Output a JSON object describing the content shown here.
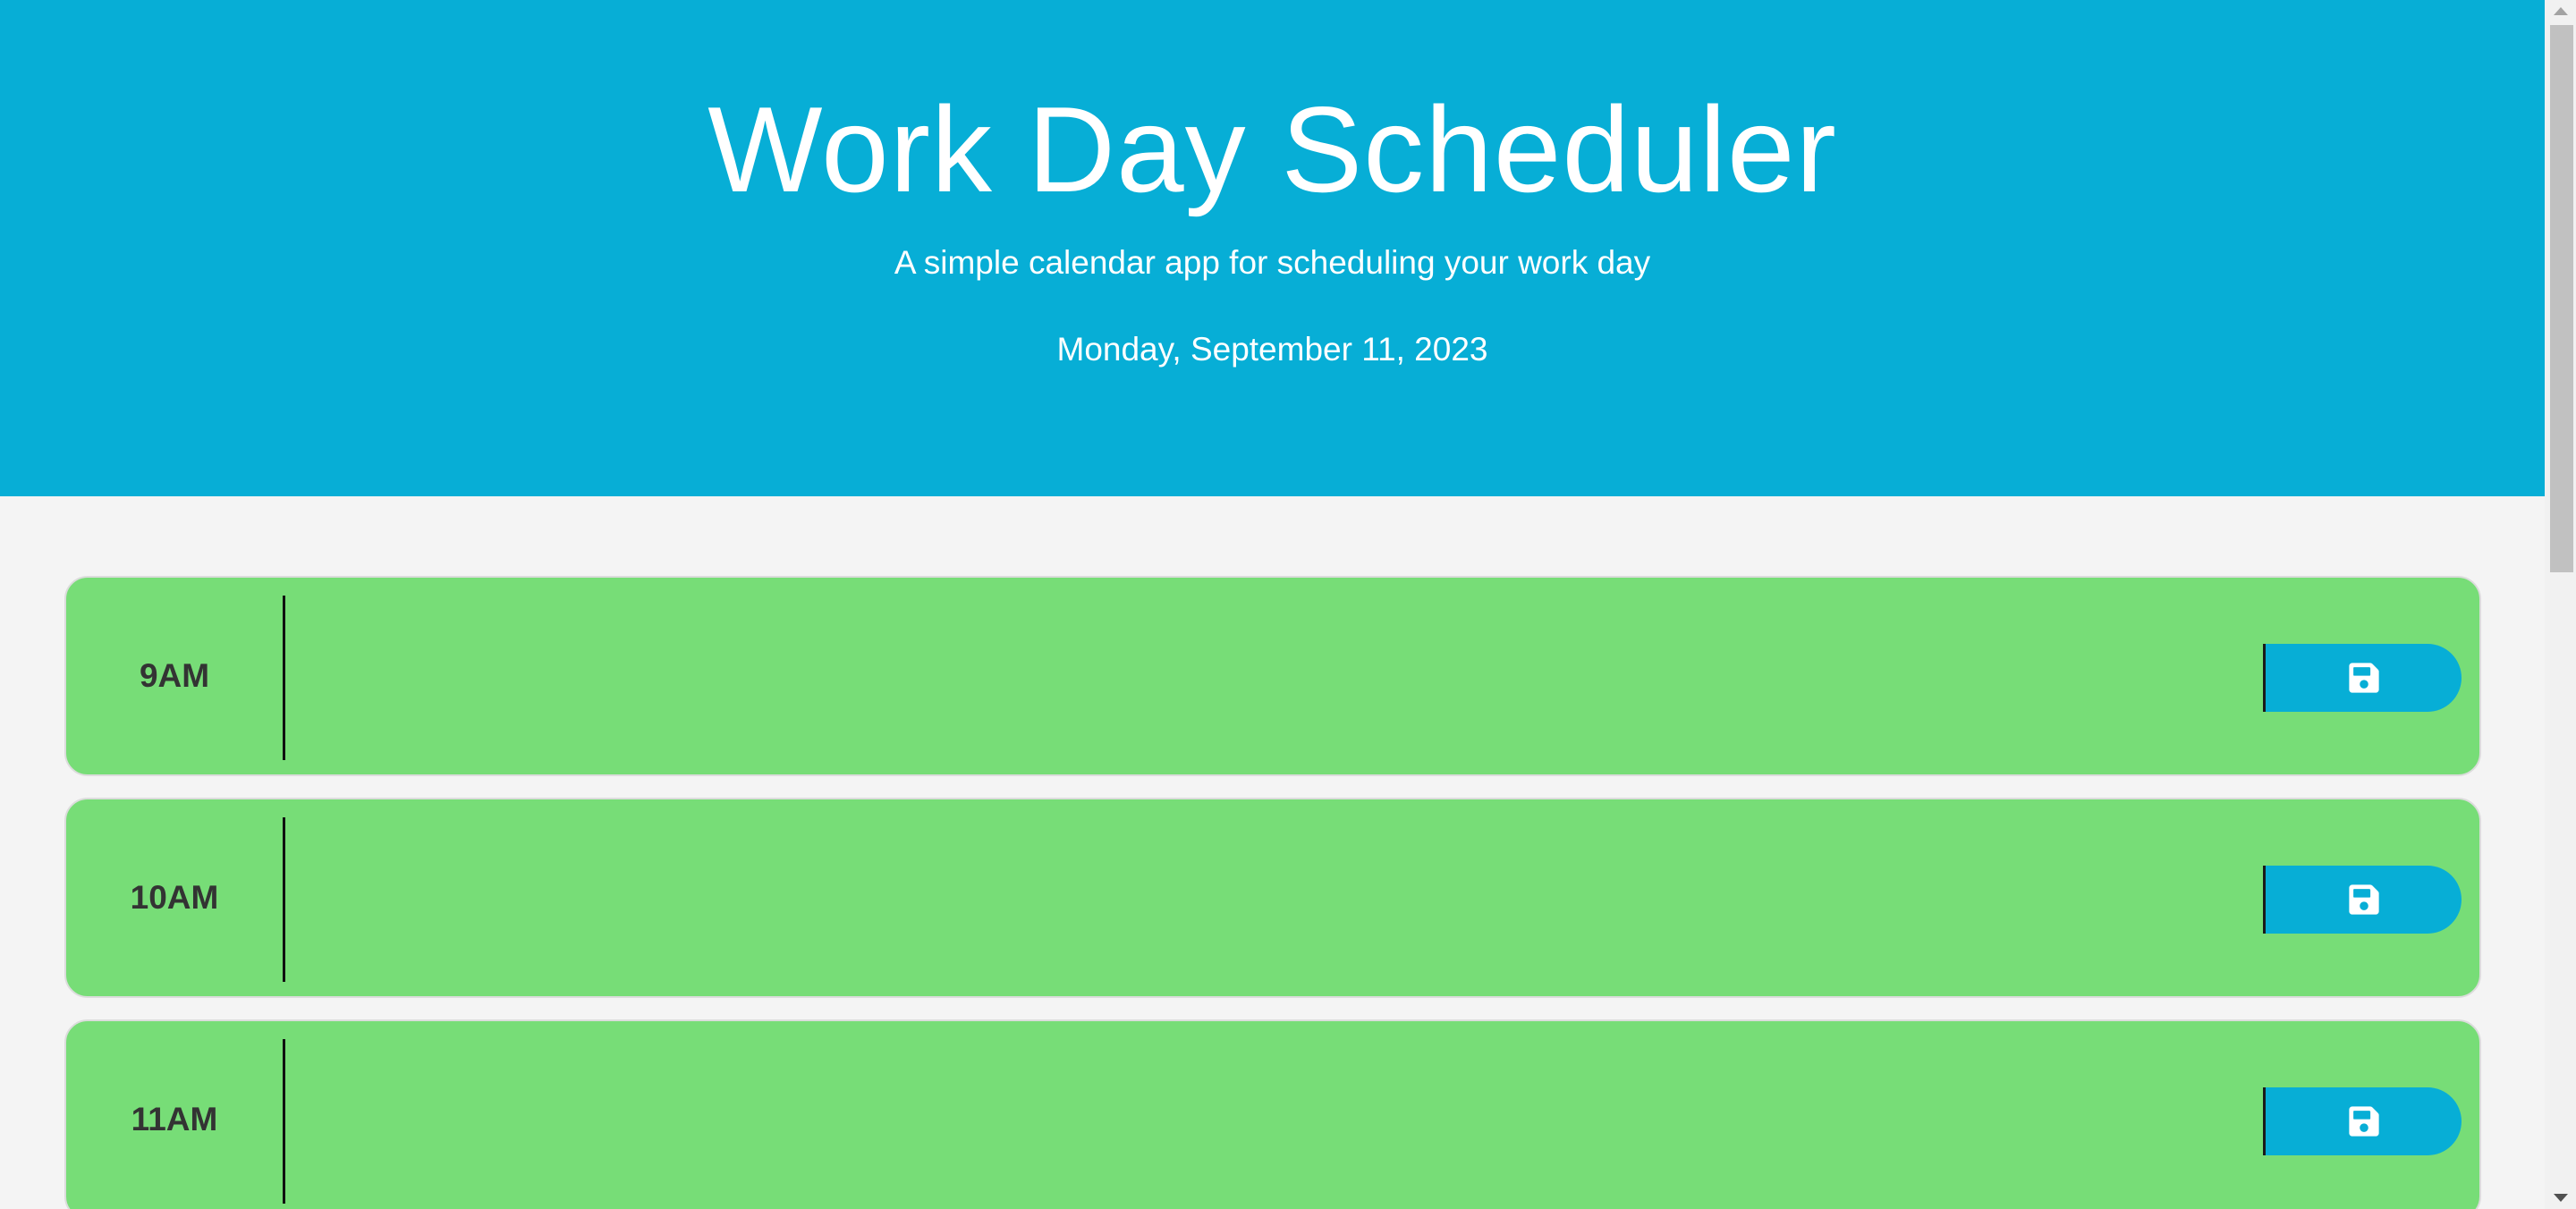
{
  "header": {
    "title": "Work Day Scheduler",
    "subtitle": "A simple calendar app for scheduling your work day",
    "current_day": "Monday, September 11, 2023"
  },
  "time_blocks": [
    {
      "hour": "9AM",
      "description": "",
      "state": "future"
    },
    {
      "hour": "10AM",
      "description": "",
      "state": "future"
    },
    {
      "hour": "11AM",
      "description": "",
      "state": "future"
    }
  ],
  "icons": {
    "save": "floppy-disk-icon"
  },
  "colors": {
    "header_background": "#07aed6",
    "future_block": "#77dd77",
    "save_button": "#07aed6",
    "page_background": "#f4f4f4"
  }
}
